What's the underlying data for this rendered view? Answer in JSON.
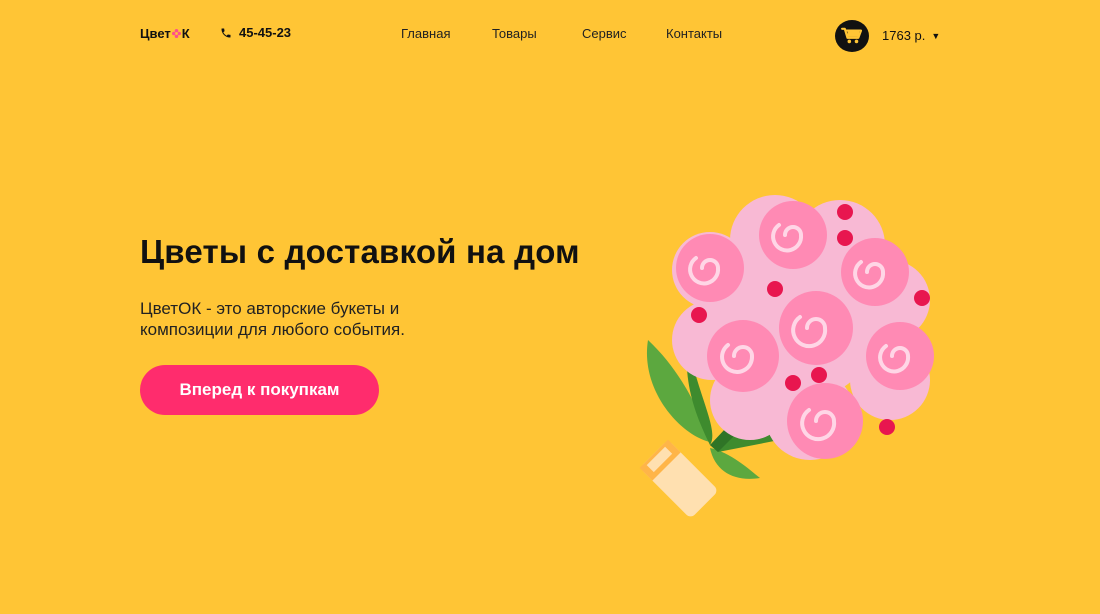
{
  "header": {
    "logo": {
      "part1": "Цвет",
      "part2": "К"
    },
    "phone": "45-45-23",
    "nav": [
      {
        "label": "Главная",
        "name": "nav-home"
      },
      {
        "label": "Товары",
        "name": "nav-products"
      },
      {
        "label": "Сервис",
        "name": "nav-service"
      },
      {
        "label": "Контакты",
        "name": "nav-contacts"
      }
    ],
    "cart_total": "1763 р.",
    "caret": "▼"
  },
  "hero": {
    "title": "Цветы с доставкой на дом",
    "description": "ЦветОК - это авторские букеты и композиции для любого события.",
    "cta_label": "Вперед к покупкам"
  },
  "colors": {
    "background": "#FFC535",
    "accent": "#FF2C6D",
    "text": "#111111"
  },
  "icons": [
    "flower-logo-icon",
    "phone-icon",
    "cart-icon",
    "chevron-down-icon",
    "bouquet-illustration"
  ]
}
